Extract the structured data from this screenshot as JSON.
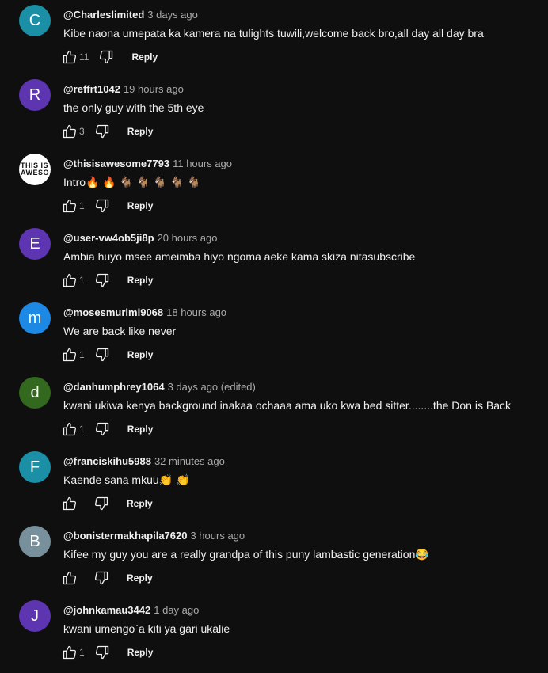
{
  "comments": [
    {
      "avatar_letter": "C",
      "avatar_color": "#1b8fa5",
      "author": "@Charleslimited",
      "time": "3 days ago",
      "text": "Kibe naona umepata ka kamera na tulights tuwili,welcome back bro,all day all day bra",
      "likes": "11",
      "reply_label": "Reply"
    },
    {
      "avatar_letter": "R",
      "avatar_color": "#5e35b1",
      "author": "@reffrt1042",
      "time": "19 hours ago",
      "text": "the only guy with the 5th eye",
      "likes": "3",
      "reply_label": "Reply"
    },
    {
      "avatar_image_text": [
        "THIS IS",
        "AWESO"
      ],
      "author": "@thisisawesome7793",
      "time": "11 hours ago",
      "text": "Intro🔥 🔥 🐐 🐐 🐐 🐐 🐐",
      "likes": "1",
      "reply_label": "Reply"
    },
    {
      "avatar_letter": "E",
      "avatar_color": "#5e35b1",
      "author": "@user-vw4ob5ji8p",
      "time": "20 hours ago",
      "text": "Ambia huyo msee ameimba hiyo ngoma aeke kama skiza nitasubscribe",
      "likes": "1",
      "reply_label": "Reply"
    },
    {
      "avatar_letter": "m",
      "avatar_color": "#1e88e5",
      "author": "@mosesmurimi9068",
      "time": "18 hours ago",
      "text": "We are back like never",
      "likes": "1",
      "reply_label": "Reply"
    },
    {
      "avatar_letter": "d",
      "avatar_color": "#33691e",
      "author": "@danhumphrey1064",
      "time": "3 days ago (edited)",
      "text": "kwani  ukiwa  kenya  background  inakaa  ochaaa   ama uko kwa bed sitter........the Don  is Back",
      "likes": "1",
      "reply_label": "Reply"
    },
    {
      "avatar_letter": "F",
      "avatar_color": "#1b8fa5",
      "author": "@franciskihu5988",
      "time": "32 minutes ago",
      "text": "Kaende sana mkuu👏 👏",
      "likes": "",
      "reply_label": "Reply"
    },
    {
      "avatar_letter": "B",
      "avatar_color": "#78909c",
      "author": "@bonistermakhapila7620",
      "time": "3 hours ago",
      "text": "Kifee my guy you are a really grandpa of this puny lambastic generation😂",
      "likes": "",
      "reply_label": "Reply"
    },
    {
      "avatar_letter": "J",
      "avatar_color": "#5e35b1",
      "author": "@johnkamau3442",
      "time": "1 day ago",
      "text": "kwani umengo`a kiti ya gari ukalie",
      "likes": "1",
      "reply_label": "Reply"
    }
  ]
}
